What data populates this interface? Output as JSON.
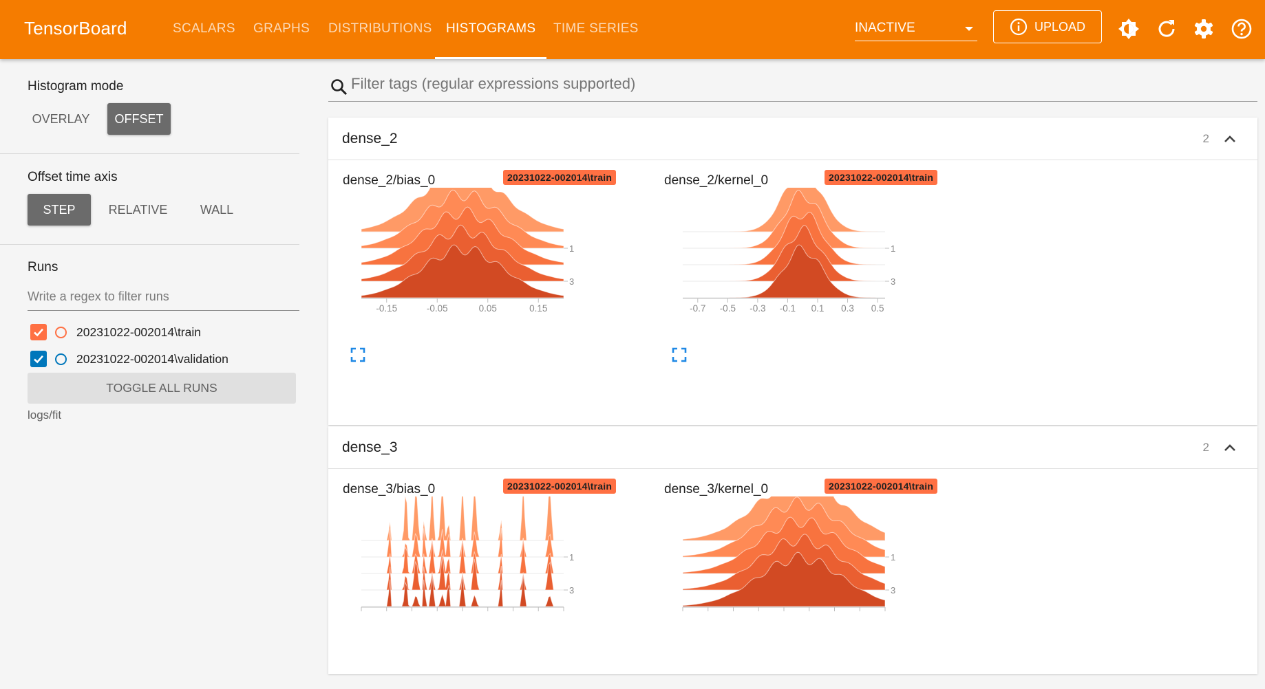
{
  "header": {
    "title": "TensorBoard",
    "tabs": [
      {
        "label": "SCALARS",
        "active": false
      },
      {
        "label": "GRAPHS",
        "active": false
      },
      {
        "label": "DISTRIBUTIONS",
        "active": false
      },
      {
        "label": "HISTOGRAMS",
        "active": true
      },
      {
        "label": "TIME SERIES",
        "active": false
      }
    ],
    "run_select": "INACTIVE",
    "upload_label": "UPLOAD",
    "icons": [
      "info-icon",
      "theme-toggle-icon",
      "refresh-icon",
      "settings-gear-icon",
      "help-icon"
    ]
  },
  "sidebar": {
    "histogram_mode": {
      "title": "Histogram mode",
      "options": [
        "OVERLAY",
        "OFFSET"
      ],
      "selected": "OFFSET"
    },
    "offset_time_axis": {
      "title": "Offset time axis",
      "options": [
        "STEP",
        "RELATIVE",
        "WALL"
      ],
      "selected": "STEP"
    },
    "runs": {
      "title": "Runs",
      "filter_placeholder": "Write a regex to filter runs",
      "items": [
        {
          "name": "20231022-002014\\train",
          "checked": true,
          "color": "#ff7043"
        },
        {
          "name": "20231022-002014\\validation",
          "checked": true,
          "color": "#0077bb"
        }
      ],
      "toggle_all": "TOGGLE ALL RUNS",
      "logdir": "logs/fit"
    }
  },
  "main": {
    "search_placeholder": "Filter tags (regular expressions supported)",
    "cards": [
      {
        "title": "dense_2",
        "count": "2",
        "plots": [
          {
            "title": "dense_2/bias_0",
            "run": "20231022-002014\\train"
          },
          {
            "title": "dense_2/kernel_0",
            "run": "20231022-002014\\train"
          }
        ]
      },
      {
        "title": "dense_3",
        "count": "2",
        "plots": [
          {
            "title": "dense_3/bias_0",
            "run": "20231022-002014\\train"
          },
          {
            "title": "dense_3/kernel_0",
            "run": "20231022-002014\\train"
          }
        ]
      }
    ]
  },
  "colors": {
    "accent": "#f57c00",
    "toggle_on": "#6b6b6b",
    "run_train": "#ff7043",
    "run_validation": "#0077bb",
    "hist_fills": [
      "#ff9a66",
      "#ff8a55",
      "#f8733f",
      "#ea5f31",
      "#d24a23"
    ]
  },
  "chart_data": [
    {
      "type": "area",
      "name": "dense_2/bias_0",
      "x_ticks": [
        "-0.15",
        "-0.05",
        "0.05",
        "0.15"
      ],
      "x_range": [
        -0.2,
        0.2
      ],
      "step_ticks": [
        "1",
        "3"
      ],
      "steps": [
        0,
        1,
        2,
        3,
        4
      ],
      "center": 0.0,
      "spread": 0.05
    },
    {
      "type": "area",
      "name": "dense_2/kernel_0",
      "x_ticks": [
        "-0.7",
        "-0.5",
        "-0.3",
        "-0.1",
        "0.1",
        "0.3",
        "0.5"
      ],
      "x_range": [
        -0.8,
        0.55
      ],
      "step_ticks": [
        "1",
        "3"
      ],
      "steps": [
        0,
        1,
        2,
        3,
        4
      ],
      "center": 0.0,
      "spread": 0.08
    },
    {
      "type": "area",
      "name": "dense_3/bias_0",
      "x_ticks": [],
      "step_ticks": [
        "1",
        "3"
      ],
      "steps": [
        0,
        1,
        2,
        3,
        4
      ],
      "spiky": true
    },
    {
      "type": "area",
      "name": "dense_3/kernel_0",
      "x_ticks": [],
      "step_ticks": [
        "1",
        "3"
      ],
      "steps": [
        0,
        1,
        2,
        3,
        4
      ],
      "center": 0.0,
      "spread": 0.13
    }
  ]
}
